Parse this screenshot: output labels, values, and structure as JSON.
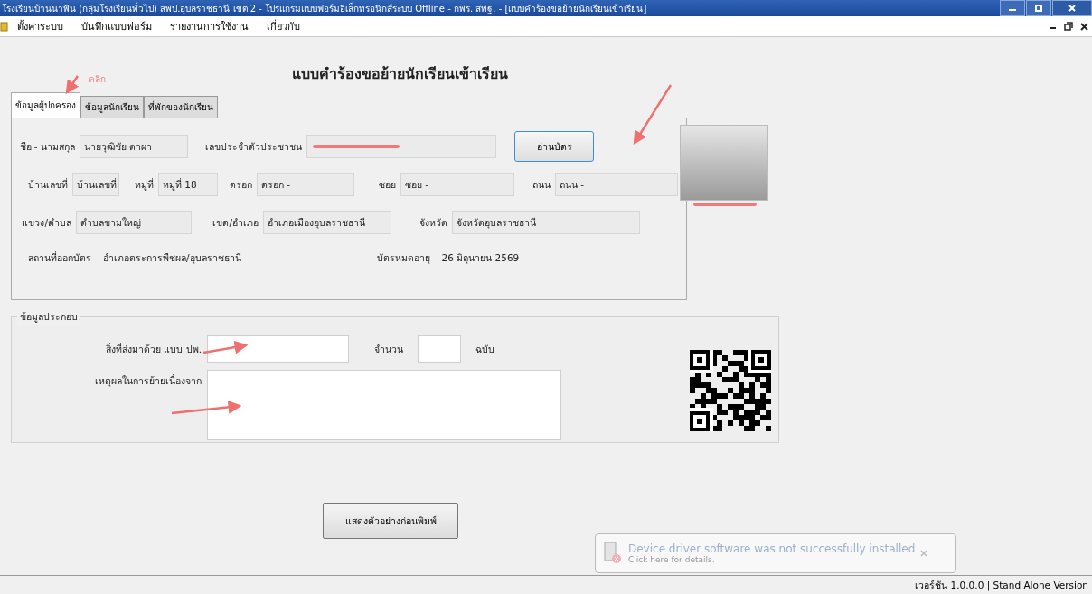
{
  "window": {
    "title": "โรงเรียนบ้านนาพิน (กลุ่มโรงเรียนทั่วไป) สพป.อุบลราชธานี เขต 2 - โปรแกรมแบบฟอร์มอิเล็กทรอนิกส์ระบบ Offline - กพร. สพฐ. - [แบบคำร้องขอย้ายนักเรียนเข้าเรียน]"
  },
  "menu": [
    {
      "label": "ตั้งค่าระบบ"
    },
    {
      "label": "บันทึกแบบฟอร์ม"
    },
    {
      "label": "รายงานการใช้งาน"
    },
    {
      "label": "เกี่ยวกับ"
    }
  ],
  "annotation": {
    "label": "คลิก"
  },
  "form_title": "แบบคำร้องขอย้ายนักเรียนเข้าเรียน",
  "tabs": [
    {
      "label": "ข้อมูลผู้ปกครอง",
      "selected": true
    },
    {
      "label": "ข้อมูลนักเรียน",
      "selected": false
    },
    {
      "label": "ที่พักของนักเรียน",
      "selected": false
    }
  ],
  "guardian": {
    "fields": [
      {
        "label": "ชื่อ - นามสกุล",
        "value": "นายวุฒิชัย ดาผา",
        "kind": "field"
      },
      {
        "label": "เลขประจำตัวประชาชน",
        "kind": "redacted"
      },
      {
        "label": "บ้านเลขที่",
        "value": "บ้านเลขที่",
        "kind": "field"
      },
      {
        "label": "หมู่ที่",
        "value": "หมู่ที่ 18",
        "kind": "field"
      },
      {
        "label": "ตรอก",
        "value": "ตรอก -",
        "kind": "field"
      },
      {
        "label": "ซอย",
        "value": "ซอย -",
        "kind": "field"
      },
      {
        "label": "ถนน",
        "value": "ถนน -",
        "kind": "field"
      },
      {
        "label": "แขวง/ตำบล",
        "value": "ตำบลขามใหญ่",
        "kind": "field"
      },
      {
        "label": "เขต/อำเภอ",
        "value": "อำเภอเมืองอุบลราชธานี",
        "kind": "field"
      },
      {
        "label": "จังหวัด",
        "value": "จังหวัดอุบลราชธานี",
        "kind": "field"
      },
      {
        "label": "สถานที่ออกบัตร",
        "value": "อำเภอตระการพืชผล/อุบลราชธานี",
        "kind": "plain"
      },
      {
        "label": "บัตรหมดอายุ",
        "value": "26 มิถุนายน 2569",
        "kind": "plain"
      }
    ],
    "read_card_button": "อ่านบัตร"
  },
  "extra": {
    "legend": "ข้อมูลประกอบ",
    "sent_label": "สิ่งที่ส่งมาด้วย แบบ ปพ.",
    "count_label": "จำนวน",
    "unit": "ฉบับ",
    "reason_label": "เหตุผลในการย้ายเนื่องจาก"
  },
  "preview_button": "แสดงตัวอย่างก่อนพิมพ์",
  "notification": {
    "title": "Device driver software was not successfully installed",
    "detail": "Click here for details."
  },
  "status_bar": {
    "version": "เวอร์ชัน 1.0.0.0 | Stand Alone Version"
  }
}
